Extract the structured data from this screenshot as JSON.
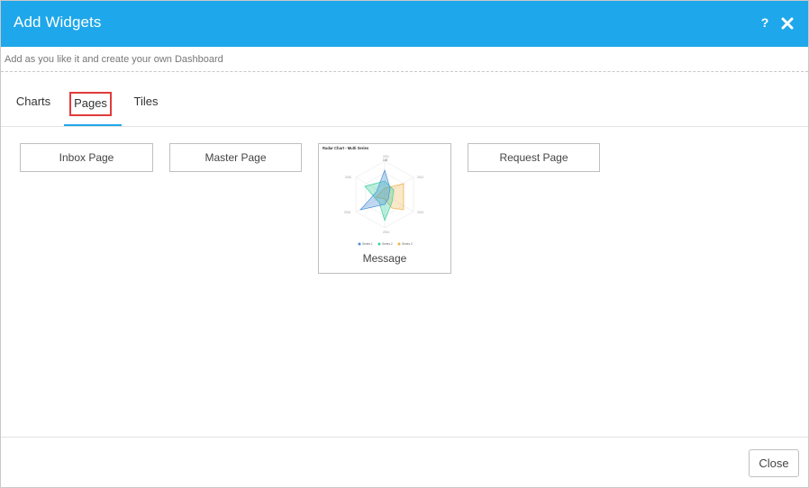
{
  "dialog": {
    "title": "Add Widgets",
    "help_icon": "question-icon",
    "help_glyph": "?",
    "close_icon": "close-icon",
    "subtitle": "Add as you like it and create your own Dashboard",
    "accent_color": "#1ea7ea",
    "highlight_color": "#e03a3a"
  },
  "tabs": [
    {
      "label": "Charts",
      "active": false
    },
    {
      "label": "Pages",
      "active": true
    },
    {
      "label": "Tiles",
      "active": false
    }
  ],
  "widgets": {
    "inbox": "Inbox Page",
    "master": "Master Page",
    "message": "Message",
    "request": "Request Page"
  },
  "thumbnail": {
    "title": "Radar Chart - Multi Series",
    "axis_labels": [
      "2011",
      "2012",
      "2013",
      "2014",
      "2015",
      "2010"
    ],
    "top_tick": "100",
    "legend": [
      "Series 1",
      "Series 2",
      "Series 3"
    ],
    "series_colors": [
      "#4a90d9",
      "#3ccfa0",
      "#f0b24a"
    ]
  },
  "footer": {
    "close_label": "Close"
  }
}
